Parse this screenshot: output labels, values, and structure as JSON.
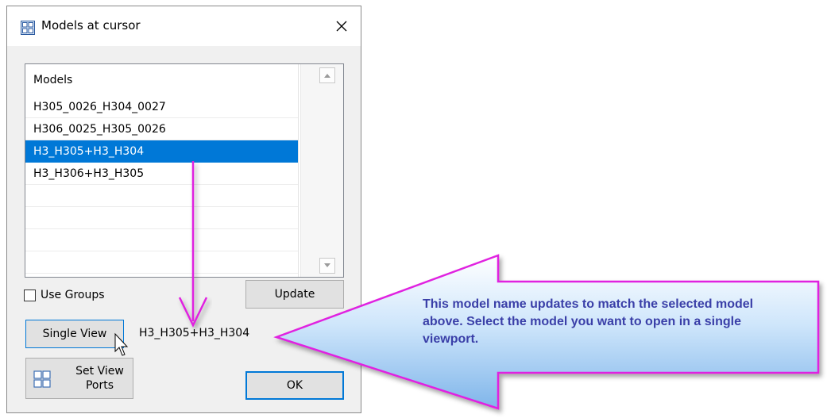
{
  "window": {
    "title": "Models at cursor"
  },
  "list": {
    "header": "Models",
    "items": [
      "H305_0026_H304_0027",
      "H306_0025_H305_0026",
      "H3_H305+H3_H304",
      "H3_H306+H3_H305"
    ],
    "selected_index": 2
  },
  "controls": {
    "use_groups_label": "Use Groups",
    "use_groups_checked": false,
    "update_label": "Update",
    "single_view_label": "Single View",
    "single_view_model": "H3_H305+H3_H304",
    "set_view_ports_line1": "Set View",
    "set_view_ports_line2": "Ports",
    "ok_label": "OK"
  },
  "callout": {
    "text": "This model name updates to match the selected model above. Select the model you want to open in a single viewport."
  },
  "colors": {
    "selection": "#0078d7",
    "arrow": "#e020e0",
    "callout_text": "#3a3fa8"
  },
  "icons": [
    "window-icon",
    "close-icon",
    "scroll-up-icon",
    "scroll-down-icon",
    "viewports-icon",
    "cursor-icon"
  ]
}
